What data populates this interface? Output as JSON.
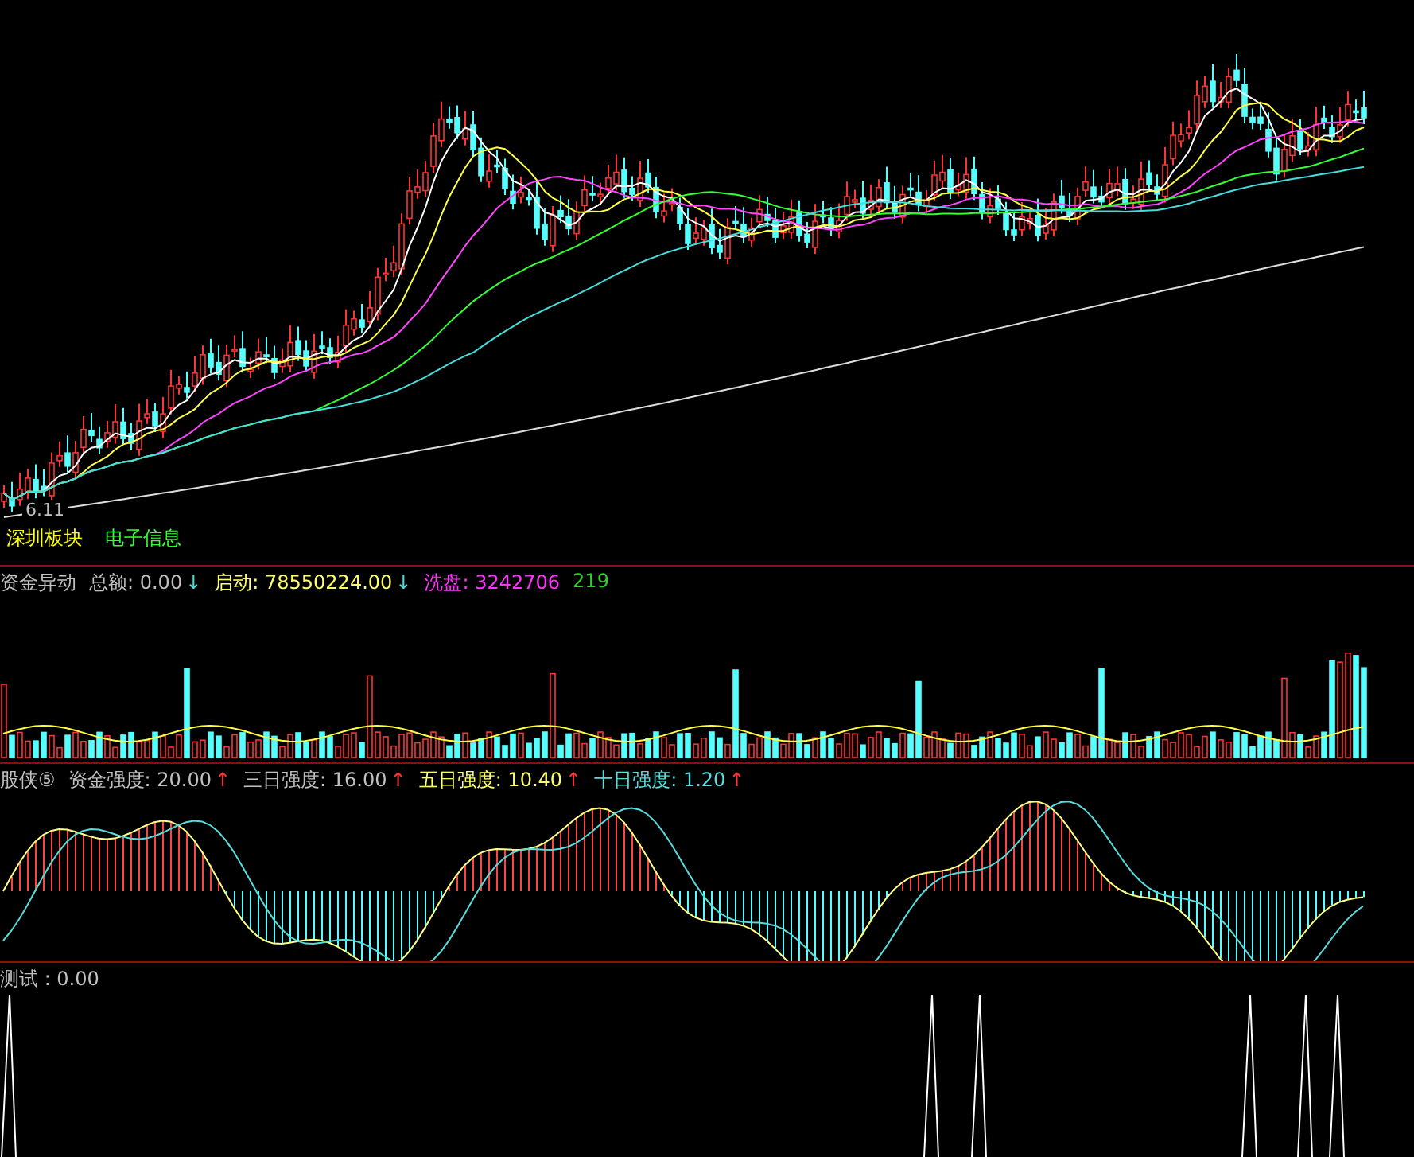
{
  "main_chart": {
    "labels": [
      {
        "text": "深圳板块",
        "color": "#ffff00"
      },
      {
        "text": "电子信息",
        "color": "#33ff33"
      }
    ],
    "low_mark": "6.11"
  },
  "panels": [
    {
      "kind": "volume",
      "indicators": [
        {
          "label": "资金异动",
          "color": "#c0c0c0"
        },
        {
          "label": "总额: 0.00",
          "arrow": "↓",
          "color": "#c0c0c0"
        },
        {
          "label": "启动: 78550224.00",
          "arrow": "↓",
          "color": "#ffff66"
        },
        {
          "label": "洗盘: 3242706",
          "color": "#ff33ff"
        },
        {
          "label": "219",
          "color": "#33cc33"
        }
      ]
    },
    {
      "kind": "oscillator",
      "indicators": [
        {
          "label": "股侠⑤",
          "color": "#c0c0c0"
        },
        {
          "label": "资金强度: 20.00",
          "arrow": "↑",
          "color": "#c0c0c0"
        },
        {
          "label": "三日强度: 16.00",
          "arrow": "↑",
          "color": "#c0c0c0"
        },
        {
          "label": "五日强度: 10.40",
          "arrow": "↑",
          "color": "#ffff66"
        },
        {
          "label": "十日强度: 1.20",
          "arrow": "↑",
          "color": "#55dddd"
        }
      ]
    },
    {
      "kind": "signal",
      "indicators": [
        {
          "label": "测试 : 0.00",
          "color": "#c0c0c0"
        }
      ]
    }
  ]
}
